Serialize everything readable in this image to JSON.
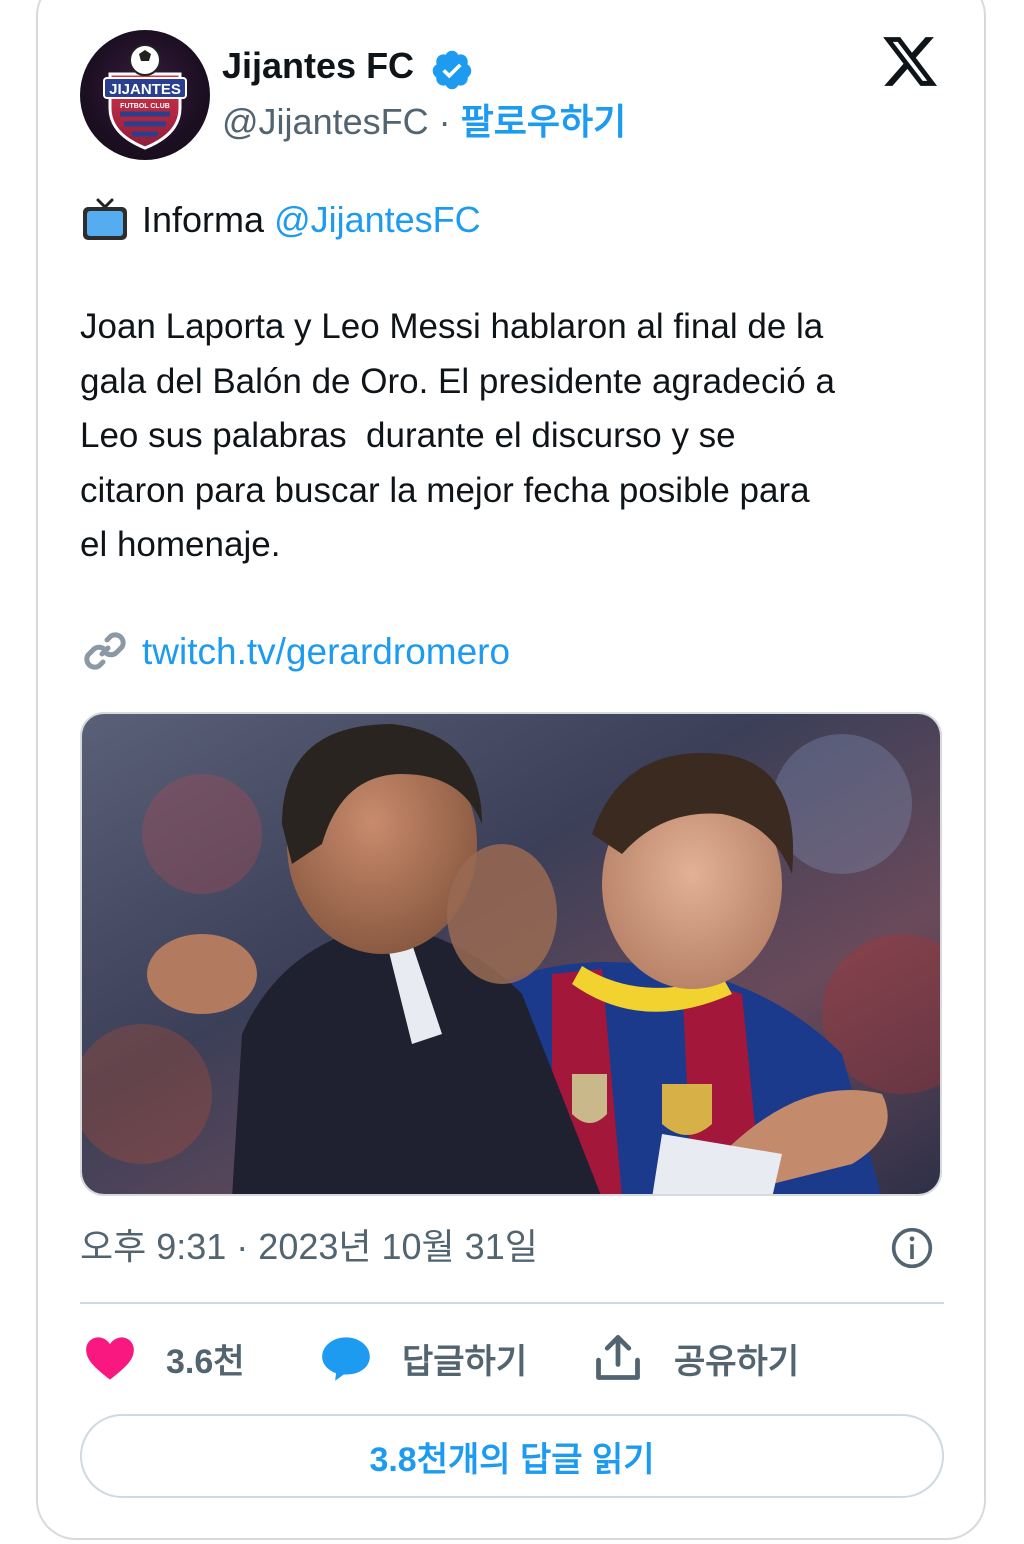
{
  "author": {
    "name": "Jijantes FC",
    "handle": "@JijantesFC",
    "separator": "·",
    "follow_label": "팔로우하기",
    "avatar_text": "JIJANTES",
    "avatar_subtext": "FUTBOL CLUB"
  },
  "tweet": {
    "lead": "Informa",
    "lead_mention": "@JijantesFC",
    "body": "Joan Laporta y Leo Messi hablaron al final de la\ngala del Balón de Oro. El presidente agradeció a\nLeo sus palabras  durante el discurso y se\ncitaron para buscar la mejor fecha posible para\nel homenaje.",
    "link_text": "twitch.tv/gerardromero"
  },
  "meta": {
    "timestamp": "오후 9:31 · 2023년 10월 31일"
  },
  "actions": {
    "like_count": "3.6천",
    "reply_label": "답글하기",
    "share_label": "공유하기",
    "read_replies_label": "3.8천개의 답글 읽기"
  },
  "colors": {
    "accent": "#1d9bf0",
    "like": "#f91880",
    "muted": "#536471",
    "text": "#0f1419"
  },
  "icons": {
    "verified": "verified-badge-icon",
    "logo": "x-logo-icon",
    "tv": "television-icon",
    "link": "link-icon",
    "info": "info-icon",
    "like": "heart-icon",
    "reply": "speech-bubble-icon",
    "share": "share-upload-icon"
  }
}
